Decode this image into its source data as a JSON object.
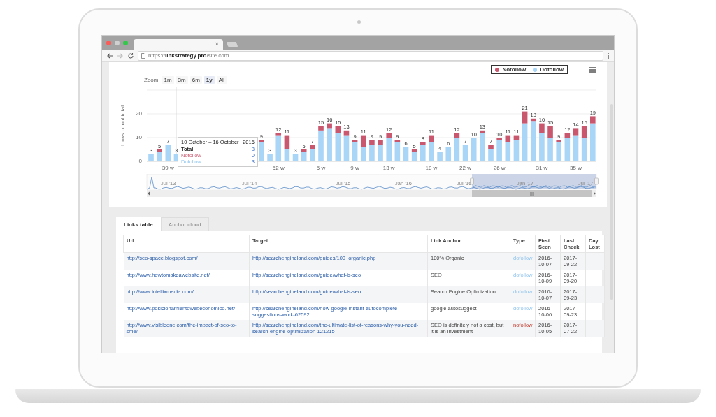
{
  "browser": {
    "url": "https://**linkstrategy.pro**/site.com",
    "tab_close": "×"
  },
  "chart": {
    "zoom_label": "Zoom",
    "zoom_buttons": [
      {
        "label": "1m",
        "selected": false
      },
      {
        "label": "3m",
        "selected": false
      },
      {
        "label": "6m",
        "selected": false
      },
      {
        "label": "1y",
        "selected": true
      },
      {
        "label": "All",
        "selected": false
      }
    ],
    "chart_data": {
      "type": "bar",
      "ylabel": "Links count total",
      "stacked": true,
      "ylim": [
        0,
        30
      ],
      "yticks": [
        0,
        10,
        20
      ],
      "categories": [
        null,
        null,
        "39 w",
        null,
        null,
        null,
        null,
        null,
        null,
        null,
        null,
        null,
        null,
        null,
        null,
        "52 w",
        null,
        null,
        null,
        null,
        "5 w",
        null,
        null,
        null,
        "9 w",
        null,
        null,
        null,
        "13 w",
        null,
        null,
        null,
        null,
        "18 w",
        null,
        null,
        null,
        "22 w",
        null,
        null,
        null,
        "26 w",
        null,
        null,
        null,
        null,
        "31 w",
        null,
        null,
        null,
        "35 w",
        null,
        null
      ],
      "value_labels": [
        "3",
        "5",
        "7",
        "3",
        null,
        null,
        null,
        null,
        null,
        null,
        null,
        null,
        null,
        "9",
        "3",
        "12",
        "11",
        "3",
        "5",
        "7",
        "15",
        "16",
        "15",
        "13",
        "9",
        "11",
        "9",
        "9",
        "12",
        "9",
        "6",
        "5",
        "8",
        "11",
        "4",
        "6",
        "12",
        "7",
        "10",
        "13",
        "7",
        "10",
        "11",
        "11",
        "21",
        "18",
        "16",
        "15",
        "9",
        "12",
        "14",
        "15",
        "19"
      ],
      "series": [
        {
          "name": "Nofollow",
          "color": "#c9586f",
          "values": [
            0,
            1,
            0,
            0,
            null,
            null,
            null,
            null,
            null,
            null,
            null,
            null,
            null,
            1,
            0,
            1,
            6,
            0,
            1,
            2,
            2,
            2,
            3,
            2,
            1,
            5,
            2,
            2,
            2,
            1,
            0,
            1,
            1,
            3,
            0,
            0,
            2,
            0,
            0,
            1,
            2,
            1,
            3,
            2,
            5,
            1,
            4,
            5,
            1,
            2,
            3,
            5,
            3
          ]
        },
        {
          "name": "Dofollow",
          "color": "#a9d5f7",
          "values": [
            3,
            4,
            7,
            3,
            null,
            null,
            null,
            null,
            null,
            null,
            null,
            null,
            null,
            8,
            3,
            11,
            5,
            3,
            4,
            5,
            13,
            14,
            12,
            11,
            8,
            6,
            7,
            7,
            10,
            8,
            6,
            4,
            7,
            8,
            4,
            6,
            10,
            7,
            10,
            12,
            5,
            9,
            8,
            9,
            16,
            17,
            12,
            10,
            8,
            10,
            11,
            10,
            16
          ]
        }
      ]
    },
    "tooltip": {
      "title": "10 October – 16 October ' 2016",
      "rows": [
        {
          "label": "Total",
          "value": "3",
          "kind": "total"
        },
        {
          "label": "Nofollow",
          "value": "0",
          "kind": "nofollow"
        },
        {
          "label": "Dofollow",
          "value": "3",
          "kind": "dofollow"
        }
      ]
    },
    "navigator": {
      "labels": [
        "Jul '13",
        "Jul '14",
        "Jul '15",
        "Jan '16",
        "Jul '16",
        "Jan '17",
        "Jul '17"
      ],
      "scroll_grip": "III"
    }
  },
  "tabs": [
    {
      "label": "Links table",
      "selected": true
    },
    {
      "label": "Anchor cloud",
      "selected": false
    }
  ],
  "table": {
    "columns": [
      "Url",
      "Target",
      "Link Anchor",
      "Type",
      "First Seen",
      "Last Check",
      "Day Lost"
    ],
    "rows": [
      {
        "url": "http://seo-space.blogspot.com/",
        "target": "http://searchengineland.com/guides/100_organic.php",
        "anchor": "100% Organic",
        "type": "dofollow",
        "kind": "dofollow",
        "first_seen": "2016-10-07",
        "last_check": "2017-09-22"
      },
      {
        "url": "http://www.howtomakeawebsite.net/",
        "target": "http://searchengineland.com/guide/what-is-seo",
        "anchor": "SEO",
        "type": "dofollow",
        "kind": "dofollow",
        "first_seen": "2016-10-09",
        "last_check": "2017-09-20"
      },
      {
        "url": "http://www.intellixmedia.com/",
        "target": "http://searchengineland.com/guide/what-is-seo",
        "anchor": "Search Engine Optimization",
        "type": "dofollow",
        "kind": "dofollow",
        "first_seen": "2016-10-07",
        "last_check": "2017-09-23"
      },
      {
        "url": "http://www.posicionamientowebeconomico.net/",
        "target": "http://searchengineland.com/how-google-instant-autocomplete-suggestions-work-62592",
        "anchor": "google autosuggest",
        "type": "dofollow",
        "kind": "dofollow",
        "first_seen": "2016-10-06",
        "last_check": "2017-09-23"
      },
      {
        "url": "http://www.visibleone.com/the-impact-of-seo-to-sme/",
        "target": "http://searchengineland.com/the-ultimate-list-of-reasons-why-you-need-search-engine-optimization-121215",
        "anchor": "SEO is definitely not a cost, but it is an investment",
        "type": "nofollow",
        "kind": "nofollow",
        "first_seen": "2016-10-05",
        "last_check": "2017-07-22"
      }
    ]
  }
}
